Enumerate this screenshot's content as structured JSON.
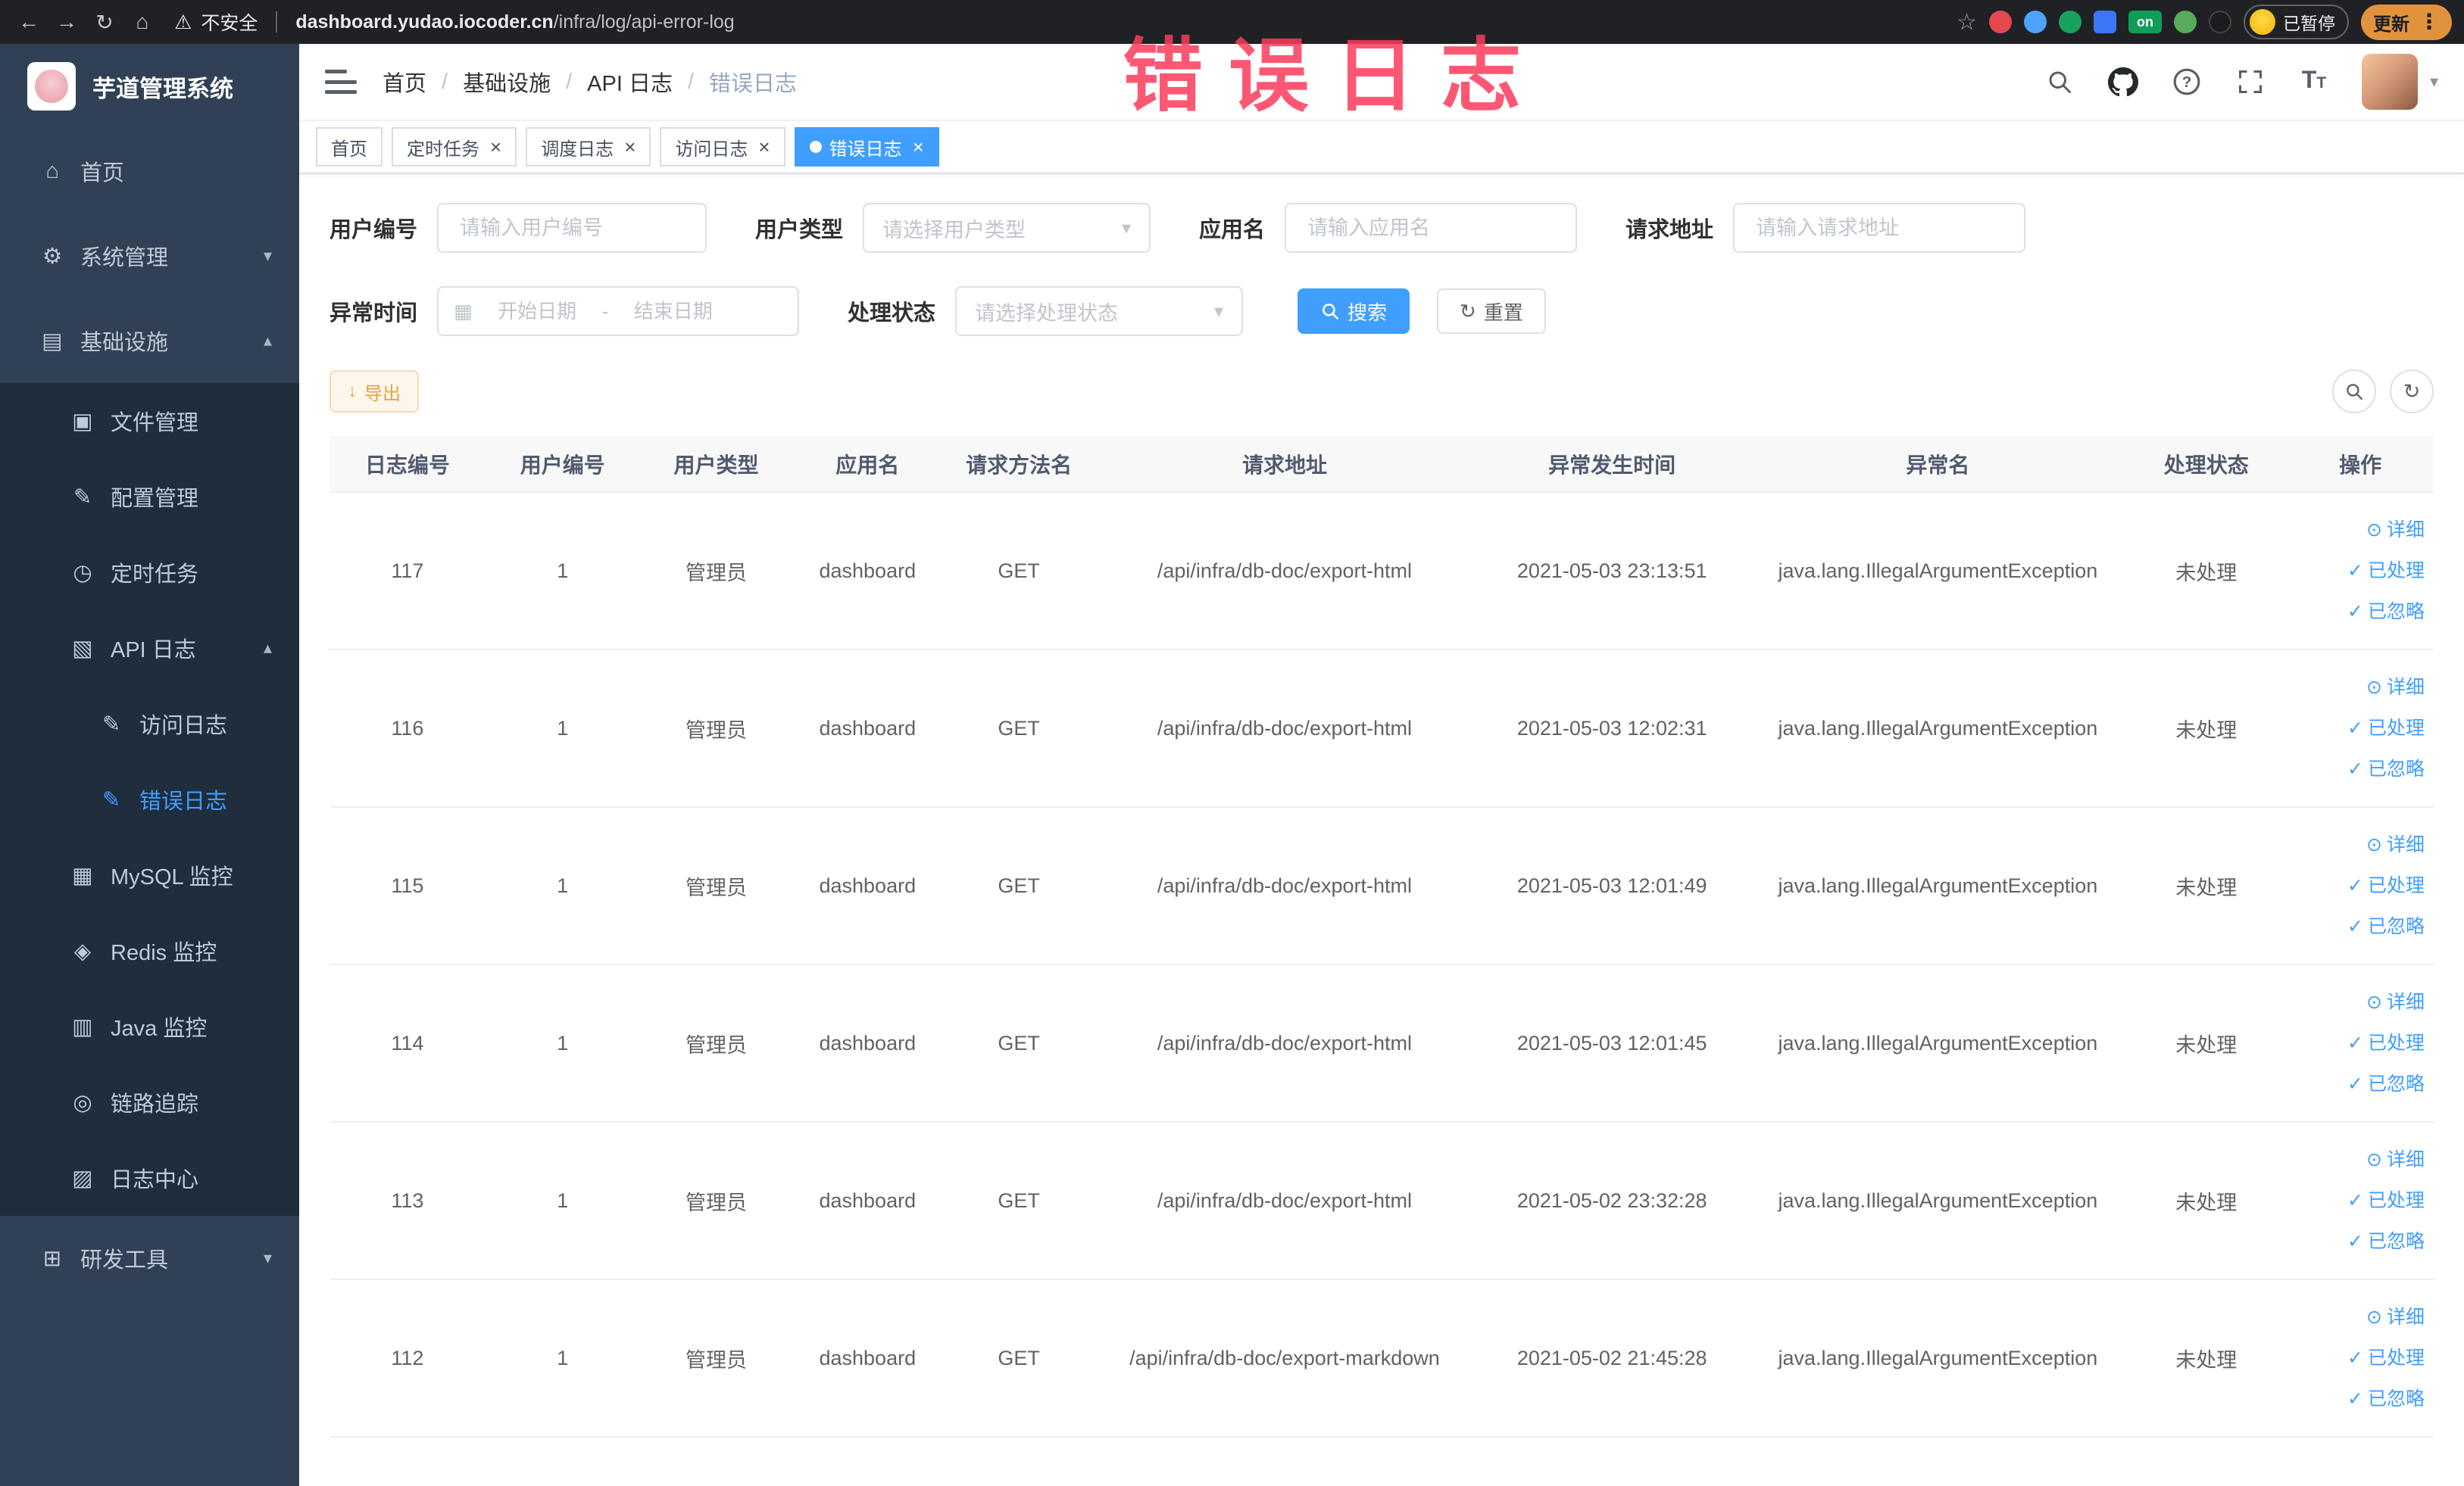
{
  "browser": {
    "security_label": "不安全",
    "url_host": "dashboard.yudao.iocoder.cn",
    "url_path": "/infra/log/api-error-log",
    "on_badge": "on",
    "paused_badge": "已暂停",
    "update_button": "更新"
  },
  "annotation": {
    "text": "错误日志"
  },
  "sidebar": {
    "logo_title": "芋道管理系统",
    "items": [
      {
        "key": "home",
        "label": "首页",
        "icon": "home-icon",
        "glyph": "⌂",
        "level": 0,
        "sub": false
      },
      {
        "key": "system-manage",
        "label": "系统管理",
        "icon": "gear-icon",
        "glyph": "⚙",
        "level": 0,
        "sub": false,
        "chevron": "down"
      },
      {
        "key": "infrastructure",
        "label": "基础设施",
        "icon": "infra-icon",
        "glyph": "▤",
        "level": 0,
        "sub": false,
        "chevron": "up"
      },
      {
        "key": "file-manage",
        "label": "文件管理",
        "icon": "file-manage-icon",
        "glyph": "▣",
        "level": 1,
        "sub": true
      },
      {
        "key": "config-manage",
        "label": "配置管理",
        "icon": "config-manage-icon",
        "glyph": "✎",
        "level": 1,
        "sub": true
      },
      {
        "key": "cron-job",
        "label": "定时任务",
        "icon": "cron-icon",
        "glyph": "◷",
        "level": 1,
        "sub": true
      },
      {
        "key": "api-log",
        "label": "API 日志",
        "icon": "api-log-icon",
        "glyph": "▧",
        "level": 1,
        "sub": true,
        "chevron": "up"
      },
      {
        "key": "access-log",
        "label": "访问日志",
        "icon": "access-log-icon",
        "glyph": "✎",
        "level": 2,
        "sub": true
      },
      {
        "key": "error-log",
        "label": "错误日志",
        "icon": "error-log-icon",
        "glyph": "✎",
        "level": 2,
        "sub": true,
        "active": true
      },
      {
        "key": "mysql-monitor",
        "label": "MySQL 监控",
        "icon": "mysql-icon",
        "glyph": "▦",
        "level": 1,
        "sub": true
      },
      {
        "key": "redis-monitor",
        "label": "Redis 监控",
        "icon": "redis-icon",
        "glyph": "◈",
        "level": 1,
        "sub": true
      },
      {
        "key": "java-monitor",
        "label": "Java 监控",
        "icon": "java-icon",
        "glyph": "▥",
        "level": 1,
        "sub": true
      },
      {
        "key": "trace",
        "label": "链路追踪",
        "icon": "trace-icon",
        "glyph": "◎",
        "level": 1,
        "sub": true
      },
      {
        "key": "log-center",
        "label": "日志中心",
        "icon": "log-center-icon",
        "glyph": "▨",
        "level": 1,
        "sub": true
      },
      {
        "key": "dev-tools",
        "label": "研发工具",
        "icon": "dev-tools-icon",
        "glyph": "⊞",
        "level": 0,
        "sub": false,
        "chevron": "down"
      }
    ]
  },
  "breadcrumb": [
    "首页",
    "基础设施",
    "API 日志",
    "错误日志"
  ],
  "tabs": [
    {
      "key": "home",
      "label": "首页",
      "closable": false,
      "active": false
    },
    {
      "key": "cron-job",
      "label": "定时任务",
      "closable": true,
      "active": false
    },
    {
      "key": "job-log",
      "label": "调度日志",
      "closable": true,
      "active": false
    },
    {
      "key": "access-log",
      "label": "访问日志",
      "closable": true,
      "active": false
    },
    {
      "key": "error-log",
      "label": "错误日志",
      "closable": true,
      "active": true
    }
  ],
  "filters": {
    "user_id": {
      "label": "用户编号",
      "placeholder": "请输入用户编号"
    },
    "user_type": {
      "label": "用户类型",
      "placeholder": "请选择用户类型"
    },
    "app_name": {
      "label": "应用名",
      "placeholder": "请输入应用名"
    },
    "request_url": {
      "label": "请求地址",
      "placeholder": "请输入请求地址"
    },
    "exception_time": {
      "label": "异常时间",
      "start_placeholder": "开始日期",
      "separator": "-",
      "end_placeholder": "结束日期"
    },
    "process_status": {
      "label": "处理状态",
      "placeholder": "请选择处理状态"
    },
    "search_button": "搜索",
    "reset_button": "重置"
  },
  "toolbar": {
    "export_button": "导出"
  },
  "table": {
    "columns": [
      "日志编号",
      "用户编号",
      "用户类型",
      "应用名",
      "请求方法名",
      "请求地址",
      "异常发生时间",
      "异常名",
      "处理状态",
      "操作"
    ],
    "column_keys": [
      "id",
      "user_id",
      "user_type",
      "app",
      "method",
      "url",
      "time",
      "exception",
      "status"
    ],
    "actions": [
      "详细",
      "已处理",
      "已忽略"
    ],
    "rows": [
      {
        "id": "117",
        "user_id": "1",
        "user_type": "管理员",
        "app": "dashboard",
        "method": "GET",
        "url": "/api/infra/db-doc/export-html",
        "time": "2021-05-03 23:13:51",
        "exception": "java.lang.IllegalArgumentException",
        "status": "未处理"
      },
      {
        "id": "116",
        "user_id": "1",
        "user_type": "管理员",
        "app": "dashboard",
        "method": "GET",
        "url": "/api/infra/db-doc/export-html",
        "time": "2021-05-03 12:02:31",
        "exception": "java.lang.IllegalArgumentException",
        "status": "未处理"
      },
      {
        "id": "115",
        "user_id": "1",
        "user_type": "管理员",
        "app": "dashboard",
        "method": "GET",
        "url": "/api/infra/db-doc/export-html",
        "time": "2021-05-03 12:01:49",
        "exception": "java.lang.IllegalArgumentException",
        "status": "未处理"
      },
      {
        "id": "114",
        "user_id": "1",
        "user_type": "管理员",
        "app": "dashboard",
        "method": "GET",
        "url": "/api/infra/db-doc/export-html",
        "time": "2021-05-03 12:01:45",
        "exception": "java.lang.IllegalArgumentException",
        "status": "未处理"
      },
      {
        "id": "113",
        "user_id": "1",
        "user_type": "管理员",
        "app": "dashboard",
        "method": "GET",
        "url": "/api/infra/db-doc/export-html",
        "time": "2021-05-02 23:32:28",
        "exception": "java.lang.IllegalArgumentException",
        "status": "未处理"
      },
      {
        "id": "112",
        "user_id": "1",
        "user_type": "管理员",
        "app": "dashboard",
        "method": "GET",
        "url": "/api/infra/db-doc/export-markdown",
        "time": "2021-05-02 21:45:28",
        "exception": "java.lang.IllegalArgumentException",
        "status": "未处理"
      }
    ]
  }
}
